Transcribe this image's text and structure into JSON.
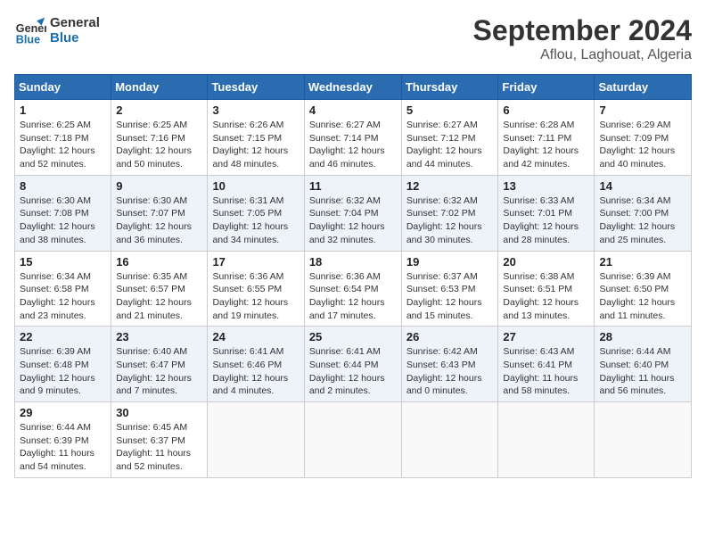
{
  "header": {
    "logo_line1": "General",
    "logo_line2": "Blue",
    "month": "September 2024",
    "location": "Aflou, Laghouat, Algeria"
  },
  "days_of_week": [
    "Sunday",
    "Monday",
    "Tuesday",
    "Wednesday",
    "Thursday",
    "Friday",
    "Saturday"
  ],
  "weeks": [
    [
      {
        "day": "1",
        "info": "Sunrise: 6:25 AM\nSunset: 7:18 PM\nDaylight: 12 hours\nand 52 minutes."
      },
      {
        "day": "2",
        "info": "Sunrise: 6:25 AM\nSunset: 7:16 PM\nDaylight: 12 hours\nand 50 minutes."
      },
      {
        "day": "3",
        "info": "Sunrise: 6:26 AM\nSunset: 7:15 PM\nDaylight: 12 hours\nand 48 minutes."
      },
      {
        "day": "4",
        "info": "Sunrise: 6:27 AM\nSunset: 7:14 PM\nDaylight: 12 hours\nand 46 minutes."
      },
      {
        "day": "5",
        "info": "Sunrise: 6:27 AM\nSunset: 7:12 PM\nDaylight: 12 hours\nand 44 minutes."
      },
      {
        "day": "6",
        "info": "Sunrise: 6:28 AM\nSunset: 7:11 PM\nDaylight: 12 hours\nand 42 minutes."
      },
      {
        "day": "7",
        "info": "Sunrise: 6:29 AM\nSunset: 7:09 PM\nDaylight: 12 hours\nand 40 minutes."
      }
    ],
    [
      {
        "day": "8",
        "info": "Sunrise: 6:30 AM\nSunset: 7:08 PM\nDaylight: 12 hours\nand 38 minutes."
      },
      {
        "day": "9",
        "info": "Sunrise: 6:30 AM\nSunset: 7:07 PM\nDaylight: 12 hours\nand 36 minutes."
      },
      {
        "day": "10",
        "info": "Sunrise: 6:31 AM\nSunset: 7:05 PM\nDaylight: 12 hours\nand 34 minutes."
      },
      {
        "day": "11",
        "info": "Sunrise: 6:32 AM\nSunset: 7:04 PM\nDaylight: 12 hours\nand 32 minutes."
      },
      {
        "day": "12",
        "info": "Sunrise: 6:32 AM\nSunset: 7:02 PM\nDaylight: 12 hours\nand 30 minutes."
      },
      {
        "day": "13",
        "info": "Sunrise: 6:33 AM\nSunset: 7:01 PM\nDaylight: 12 hours\nand 28 minutes."
      },
      {
        "day": "14",
        "info": "Sunrise: 6:34 AM\nSunset: 7:00 PM\nDaylight: 12 hours\nand 25 minutes."
      }
    ],
    [
      {
        "day": "15",
        "info": "Sunrise: 6:34 AM\nSunset: 6:58 PM\nDaylight: 12 hours\nand 23 minutes."
      },
      {
        "day": "16",
        "info": "Sunrise: 6:35 AM\nSunset: 6:57 PM\nDaylight: 12 hours\nand 21 minutes."
      },
      {
        "day": "17",
        "info": "Sunrise: 6:36 AM\nSunset: 6:55 PM\nDaylight: 12 hours\nand 19 minutes."
      },
      {
        "day": "18",
        "info": "Sunrise: 6:36 AM\nSunset: 6:54 PM\nDaylight: 12 hours\nand 17 minutes."
      },
      {
        "day": "19",
        "info": "Sunrise: 6:37 AM\nSunset: 6:53 PM\nDaylight: 12 hours\nand 15 minutes."
      },
      {
        "day": "20",
        "info": "Sunrise: 6:38 AM\nSunset: 6:51 PM\nDaylight: 12 hours\nand 13 minutes."
      },
      {
        "day": "21",
        "info": "Sunrise: 6:39 AM\nSunset: 6:50 PM\nDaylight: 12 hours\nand 11 minutes."
      }
    ],
    [
      {
        "day": "22",
        "info": "Sunrise: 6:39 AM\nSunset: 6:48 PM\nDaylight: 12 hours\nand 9 minutes."
      },
      {
        "day": "23",
        "info": "Sunrise: 6:40 AM\nSunset: 6:47 PM\nDaylight: 12 hours\nand 7 minutes."
      },
      {
        "day": "24",
        "info": "Sunrise: 6:41 AM\nSunset: 6:46 PM\nDaylight: 12 hours\nand 4 minutes."
      },
      {
        "day": "25",
        "info": "Sunrise: 6:41 AM\nSunset: 6:44 PM\nDaylight: 12 hours\nand 2 minutes."
      },
      {
        "day": "26",
        "info": "Sunrise: 6:42 AM\nSunset: 6:43 PM\nDaylight: 12 hours\nand 0 minutes."
      },
      {
        "day": "27",
        "info": "Sunrise: 6:43 AM\nSunset: 6:41 PM\nDaylight: 11 hours\nand 58 minutes."
      },
      {
        "day": "28",
        "info": "Sunrise: 6:44 AM\nSunset: 6:40 PM\nDaylight: 11 hours\nand 56 minutes."
      }
    ],
    [
      {
        "day": "29",
        "info": "Sunrise: 6:44 AM\nSunset: 6:39 PM\nDaylight: 11 hours\nand 54 minutes."
      },
      {
        "day": "30",
        "info": "Sunrise: 6:45 AM\nSunset: 6:37 PM\nDaylight: 11 hours\nand 52 minutes."
      },
      {
        "day": "",
        "info": ""
      },
      {
        "day": "",
        "info": ""
      },
      {
        "day": "",
        "info": ""
      },
      {
        "day": "",
        "info": ""
      },
      {
        "day": "",
        "info": ""
      }
    ]
  ]
}
